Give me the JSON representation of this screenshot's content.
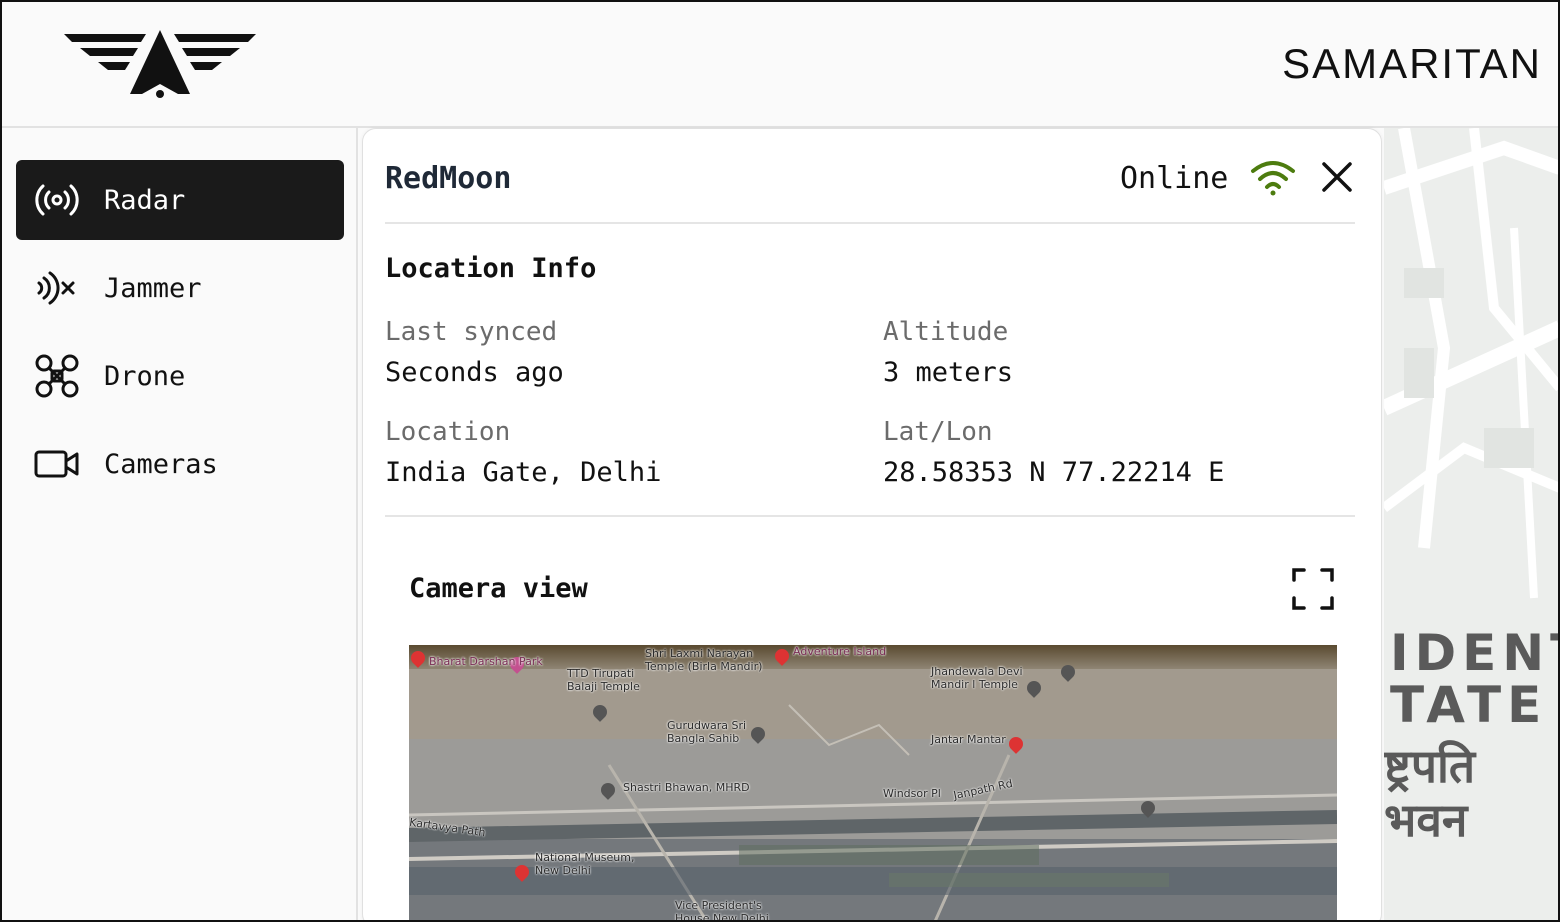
{
  "header": {
    "brand": "SAMARITAN"
  },
  "sidebar": {
    "items": [
      {
        "label": "Radar",
        "icon": "radar-icon",
        "active": true
      },
      {
        "label": "Jammer",
        "icon": "jammer-icon",
        "active": false
      },
      {
        "label": "Drone",
        "icon": "drone-icon",
        "active": false
      },
      {
        "label": "Cameras",
        "icon": "camera-icon",
        "active": false
      }
    ]
  },
  "panel": {
    "title": "RedMoon",
    "status": "Online",
    "status_color": "#4d7c0f",
    "section_title": "Location Info",
    "fields": {
      "last_synced": {
        "label": "Last synced",
        "value": "Seconds ago"
      },
      "altitude": {
        "label": "Altitude",
        "value": "3 meters"
      },
      "location": {
        "label": "Location",
        "value": "India Gate, Delhi"
      },
      "latlon": {
        "label": "Lat/Lon",
        "value": "28.58353 N 77.22214 E"
      }
    },
    "camera": {
      "title": "Camera view",
      "labels": [
        "Bharat Darshan Park",
        "TTD Tirupati Balaji Temple",
        "Shri Laxmi Narayan Temple (Birla Mandir)",
        "Adventure Island",
        "Jhandewala Devi Mandir l Temple",
        "Gurudwara Sri Bangla Sahib",
        "Jantar Mantar",
        "Shastri Bhawan, MHRD",
        "Windsor Pl",
        "Janpath Rd",
        "Kartavya Path",
        "National Museum, New Delhi",
        "Vice President's House New Delhi"
      ]
    }
  },
  "map": {
    "labels": [
      "IDENT",
      "TATE",
      "ष्ट्रपति",
      "भवन"
    ]
  }
}
